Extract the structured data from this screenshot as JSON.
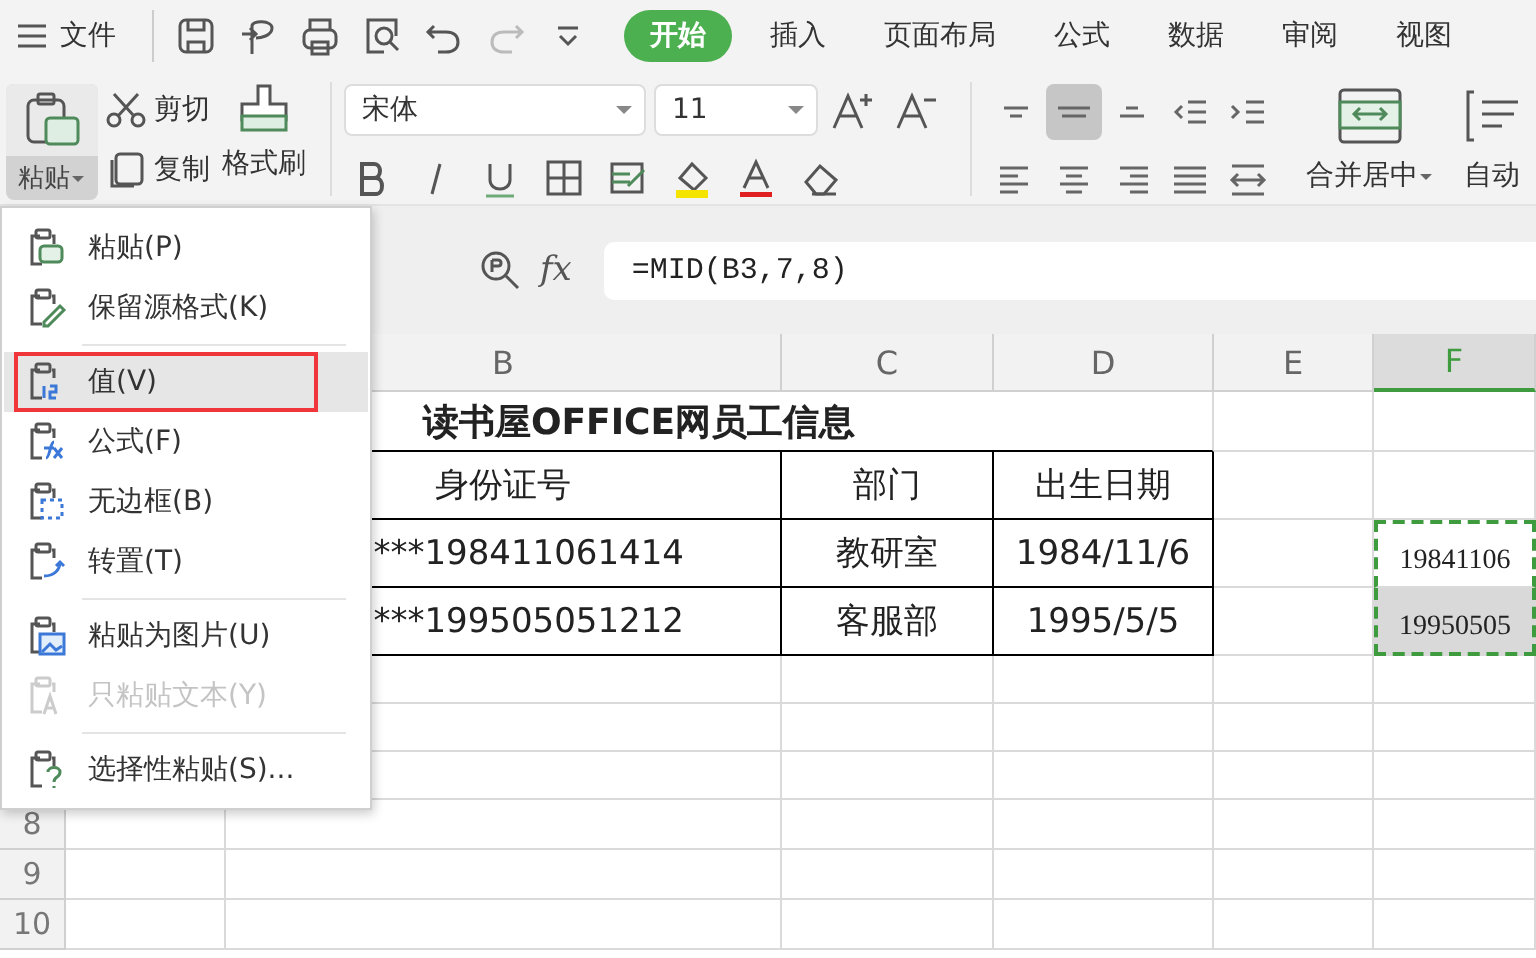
{
  "file_menu": "文件",
  "tabs": [
    {
      "label": "开始",
      "selected": true
    },
    {
      "label": "插入",
      "selected": false
    },
    {
      "label": "页面布局",
      "selected": false
    },
    {
      "label": "公式",
      "selected": false
    },
    {
      "label": "数据",
      "selected": false
    },
    {
      "label": "审阅",
      "selected": false
    },
    {
      "label": "视图",
      "selected": false
    }
  ],
  "clipboard": {
    "paste": "粘贴",
    "paste_open": true,
    "cut": "剪切",
    "copy": "复制",
    "format_painter": "格式刷"
  },
  "font": {
    "name": "宋体",
    "size": "11"
  },
  "alignment": [
    {
      "kind": "top",
      "selected": false
    },
    {
      "kind": "middle",
      "selected": true
    },
    {
      "kind": "bottom",
      "selected": false
    },
    {
      "kind": "outdent",
      "selected": false
    },
    {
      "kind": "indent",
      "selected": false
    },
    {
      "kind": "left",
      "selected": false
    },
    {
      "kind": "center",
      "selected": false
    },
    {
      "kind": "right",
      "selected": false
    },
    {
      "kind": "justify",
      "selected": false
    },
    {
      "kind": "distribute",
      "selected": false
    }
  ],
  "merge": "合并居中",
  "wrap": "自动",
  "formula_bar": {
    "fx": "fx",
    "formula": "=MID(B3,7,8)"
  },
  "columns": [
    {
      "label": "B",
      "selected": false
    },
    {
      "label": "C",
      "selected": false
    },
    {
      "label": "D",
      "selected": false
    },
    {
      "label": "E",
      "selected": false
    },
    {
      "label": "F",
      "selected": true
    }
  ],
  "row_numbers": [
    "8",
    "9",
    "10"
  ],
  "sheet": {
    "title": "读书屋OFFICE网员工信息",
    "headers": [
      "身份证号",
      "部门",
      "出生日期"
    ],
    "records": [
      {
        "id": "***198411061414",
        "dept": "教研室",
        "birth": "1984/11/6",
        "extract": "19841106",
        "selected": false
      },
      {
        "id": "***199505051212",
        "dept": "客服部",
        "birth": "1995/5/5",
        "extract": "19950505",
        "selected": true
      }
    ]
  },
  "paste_menu": {
    "groups": [
      [
        {
          "label": "粘贴(P)",
          "kind": "paste",
          "selected": false,
          "disabled": false
        },
        {
          "label": "保留源格式(K)",
          "kind": "keep",
          "selected": false,
          "disabled": false
        }
      ],
      [
        {
          "label": "值(V)",
          "kind": "values",
          "selected": true,
          "disabled": false
        },
        {
          "label": "公式(F)",
          "kind": "formula",
          "selected": false,
          "disabled": false
        },
        {
          "label": "无边框(B)",
          "kind": "noborder",
          "selected": false,
          "disabled": false
        },
        {
          "label": "转置(T)",
          "kind": "transpose",
          "selected": false,
          "disabled": false
        }
      ],
      [
        {
          "label": "粘贴为图片(U)",
          "kind": "picture",
          "selected": false,
          "disabled": false
        },
        {
          "label": "只粘贴文本(Y)",
          "kind": "text",
          "selected": false,
          "disabled": true
        }
      ],
      [
        {
          "label": "选择性粘贴(S)...",
          "kind": "special",
          "selected": false,
          "disabled": false
        }
      ]
    ]
  }
}
